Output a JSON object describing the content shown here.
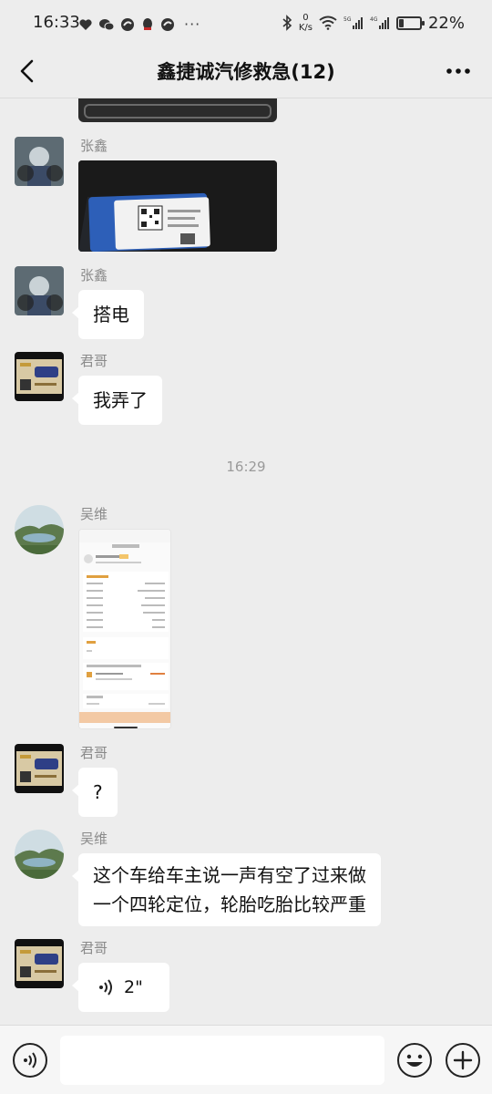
{
  "status_bar": {
    "time": "16:33",
    "net_speed_value": "0",
    "net_speed_unit": "K/s",
    "battery_percent": "22%",
    "battery_level": 0.22,
    "overflow_dots": "···"
  },
  "header": {
    "title": "鑫捷诚汽修救急(12)"
  },
  "messages": [
    {
      "sender": "张鑫",
      "type": "image"
    },
    {
      "sender": "张鑫",
      "type": "text",
      "text": "搭电"
    },
    {
      "sender": "君哥",
      "type": "text",
      "text": "我弄了"
    },
    {
      "sender": "吴维",
      "type": "image"
    },
    {
      "sender": "君哥",
      "type": "text",
      "text": "?"
    },
    {
      "sender": "吴维",
      "type": "text",
      "text_line1": "这个车给车主说一声有空了过来做",
      "text_line2": "一个四轮定位，轮胎吃胎比较严重"
    },
    {
      "sender": "君哥",
      "type": "voice",
      "duration": "2\""
    }
  ],
  "timestamp": "16:29",
  "colors": {
    "background": "#ededed",
    "bubble": "#ffffff",
    "sender_text": "#8a8a8a",
    "timestamp_text": "#9a9a9a"
  },
  "icons": {
    "back": "chevron-left-icon",
    "more": "more-horizontal-icon",
    "voice": "voice-icon",
    "emoji": "emoji-icon",
    "plus": "plus-icon"
  }
}
